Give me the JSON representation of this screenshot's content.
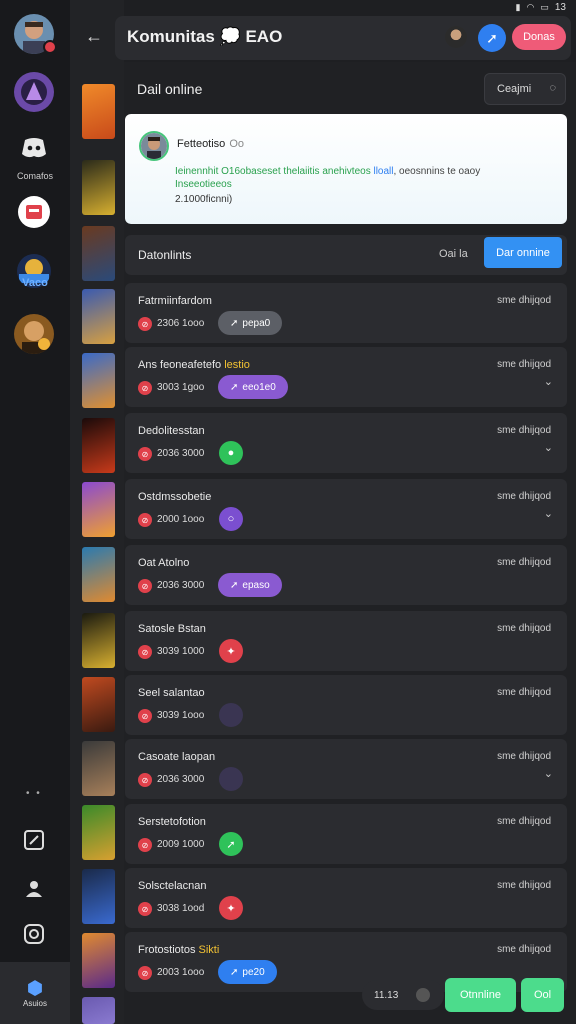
{
  "status_bar": {
    "time": "13"
  },
  "top_bar": {
    "title": "Komunitas 💭 EAO",
    "pink_button_label": "Donas"
  },
  "rail": {
    "label_1": "Comafos",
    "label_2": "Vaco",
    "dots": "• •",
    "bottom_label": "Asuios"
  },
  "main": {
    "section_title": "Dail online",
    "sort_label": "Ceajmi",
    "profile": {
      "name": "Fetteotiso",
      "status": "Oo",
      "desc_green": "Ieinennhit O16obaseset thelaiitis anehivteos",
      "desc_blue": "lloall",
      "desc_dark": ", oeosnnins te oaoy",
      "desc_green2": "Inseeotieeos",
      "meta": "2.1000ficnni)"
    },
    "list_header": {
      "title": "Datonlints",
      "count": "Oai la",
      "button_label": "Dar onnine"
    },
    "rows": [
      {
        "title": "Fatrmiinfardom",
        "highlight": "",
        "time": "sme dhijqod",
        "count": "2306 1ooo",
        "chip": "pepa0",
        "chip_icon": "➚"
      },
      {
        "title": "Ans feoneafetefo ",
        "highlight": "lestio",
        "time": "sme dhijqod",
        "count": "3003 1goo",
        "chip": "eeo1e0",
        "chip_icon": "➚"
      },
      {
        "title": "Dedolitesstan",
        "highlight": "",
        "time": "sme dhijqod",
        "count": "2036 3000",
        "round_icon": "●"
      },
      {
        "title": "Ostdmssobetie",
        "highlight": "",
        "time": "sme dhijqod",
        "count": "2000 1ooo",
        "round_icon": "○"
      },
      {
        "title": "Oat Atolno",
        "highlight": "",
        "time": "sme dhijqod",
        "count": "2036 3000",
        "chip": "epaso",
        "chip_icon": "➚"
      },
      {
        "title": "Satosle Bstan",
        "highlight": "",
        "time": "sme dhijqod",
        "count": "3039 1000",
        "round_icon": "✦"
      },
      {
        "title": "Seel salantao",
        "highlight": "",
        "time": "sme dhijqod",
        "count": "3039 1ooo",
        "round_icon": ""
      },
      {
        "title": "Casoate laopan",
        "highlight": "",
        "time": "sme dhijqod",
        "count": "2036 3000",
        "round_icon": ""
      },
      {
        "title": "Serstetofotion",
        "highlight": "",
        "time": "sme dhijqod",
        "count": "2009 1000",
        "round_icon": "➚"
      },
      {
        "title": "Solsctelacnan",
        "highlight": "",
        "time": "sme dhijqod",
        "count": "3038 1ood",
        "round_icon": "✦"
      },
      {
        "title": "Frotostiotos ",
        "highlight": "Sikti",
        "time": "sme dhijqod",
        "count": "2003 1ooo",
        "chip": "pe20",
        "chip_icon": "➚"
      }
    ]
  },
  "bottom": {
    "pill_label": "11.13",
    "green_button_1": "Otnnline",
    "green_button_2": "Ool"
  },
  "colors": {
    "background": "#1e1f22",
    "panel": "#2b2c30",
    "accent_blue": "#3391f3",
    "accent_pink": "#ef5b78",
    "accent_green": "#4cdc8c",
    "badge_red": "#e0414b"
  }
}
